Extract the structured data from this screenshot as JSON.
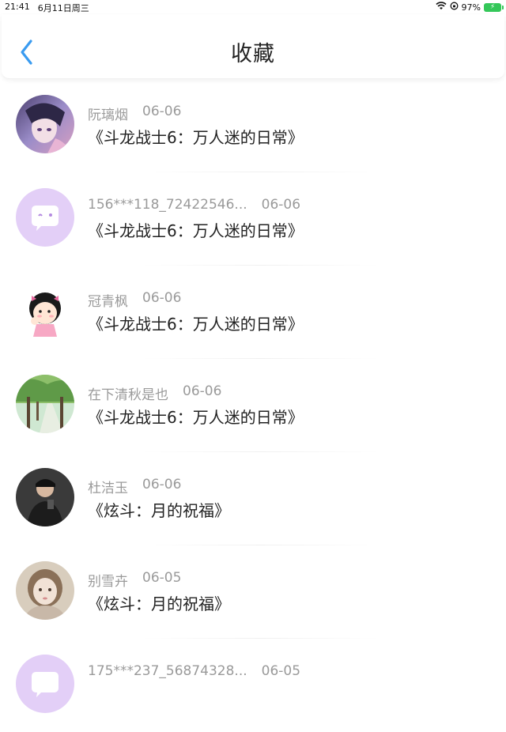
{
  "status": {
    "time": "21:41",
    "date": "6月11日周三",
    "battery": "97%"
  },
  "header": {
    "title": "收藏"
  },
  "items": [
    {
      "author": "阮璃烟",
      "date": "06-06",
      "title": "《斗龙战士6：万人迷的日常》",
      "avatar": "anime-girl-avatar"
    },
    {
      "author": "156***118_72422546...",
      "date": "06-06",
      "title": "《斗龙战士6：万人迷的日常》",
      "avatar": "chat-bubble-avatar"
    },
    {
      "author": "冠青枫",
      "date": "06-06",
      "title": "《斗龙战士6：万人迷的日常》",
      "avatar": "cartoon-girl-avatar"
    },
    {
      "author": "在下清秋是也",
      "date": "06-06",
      "title": "《斗龙战士6：万人迷的日常》",
      "avatar": "tree-road-avatar"
    },
    {
      "author": "杜洁玉",
      "date": "06-06",
      "title": "《炫斗：月的祝福》",
      "avatar": "person-dark-avatar"
    },
    {
      "author": "别雪卉",
      "date": "06-05",
      "title": "《炫斗：月的祝福》",
      "avatar": "blurry-girl-avatar"
    },
    {
      "author": "175***237_56874328...",
      "date": "06-05",
      "title": "",
      "avatar": "chat-bubble-avatar"
    }
  ],
  "colors": {
    "accent": "#3a9bf0",
    "bubble_bg": "#e3cff7",
    "meta_text": "#9a9a9a",
    "battery": "#34c759"
  }
}
